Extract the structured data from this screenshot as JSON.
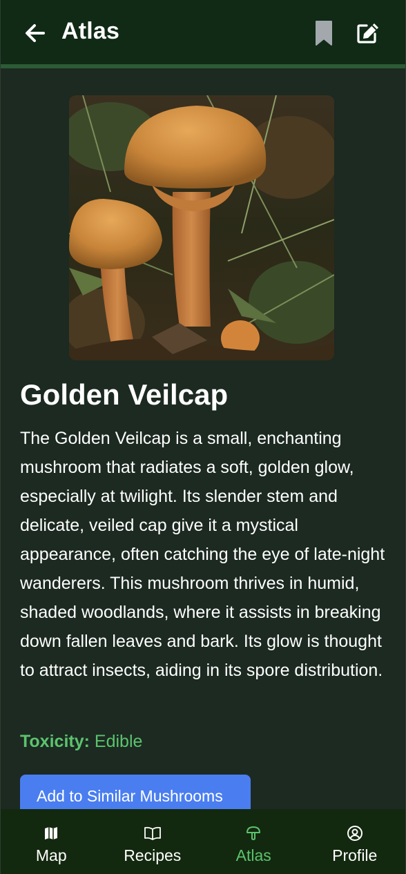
{
  "header": {
    "title": "Atlas",
    "back_icon": "arrow-left-icon",
    "bookmark_icon": "bookmark-icon",
    "edit_icon": "edit-icon"
  },
  "mushroom": {
    "name": "Golden Veilcap",
    "description": "The Golden Veilcap is a small, enchanting mushroom that radiates a soft, golden glow, especially at twilight. Its slender stem and delicate, veiled cap give it a mystical appearance, often catching the eye of late-night wanderers. This mushroom thrives in humid, shaded woodlands, where it assists in breaking down fallen leaves and bark. Its glow is thought to attract insects, aiding in its spore distribution.",
    "toxicity_label": "Toxicity:",
    "toxicity_value": "Edible",
    "add_button": "Add to Similar Mushrooms"
  },
  "nav": {
    "items": [
      {
        "label": "Map",
        "icon": "map-icon"
      },
      {
        "label": "Recipes",
        "icon": "book-icon"
      },
      {
        "label": "Atlas",
        "icon": "mushroom-icon"
      },
      {
        "label": "Profile",
        "icon": "user-circle-icon"
      }
    ],
    "active": "Atlas"
  },
  "colors": {
    "header_bg": "#102a16",
    "page_bg": "#1c2a21",
    "accent_green": "#5cc36e",
    "button_blue": "#4a7ef0",
    "bookmark_gray": "#a3a8ad"
  }
}
